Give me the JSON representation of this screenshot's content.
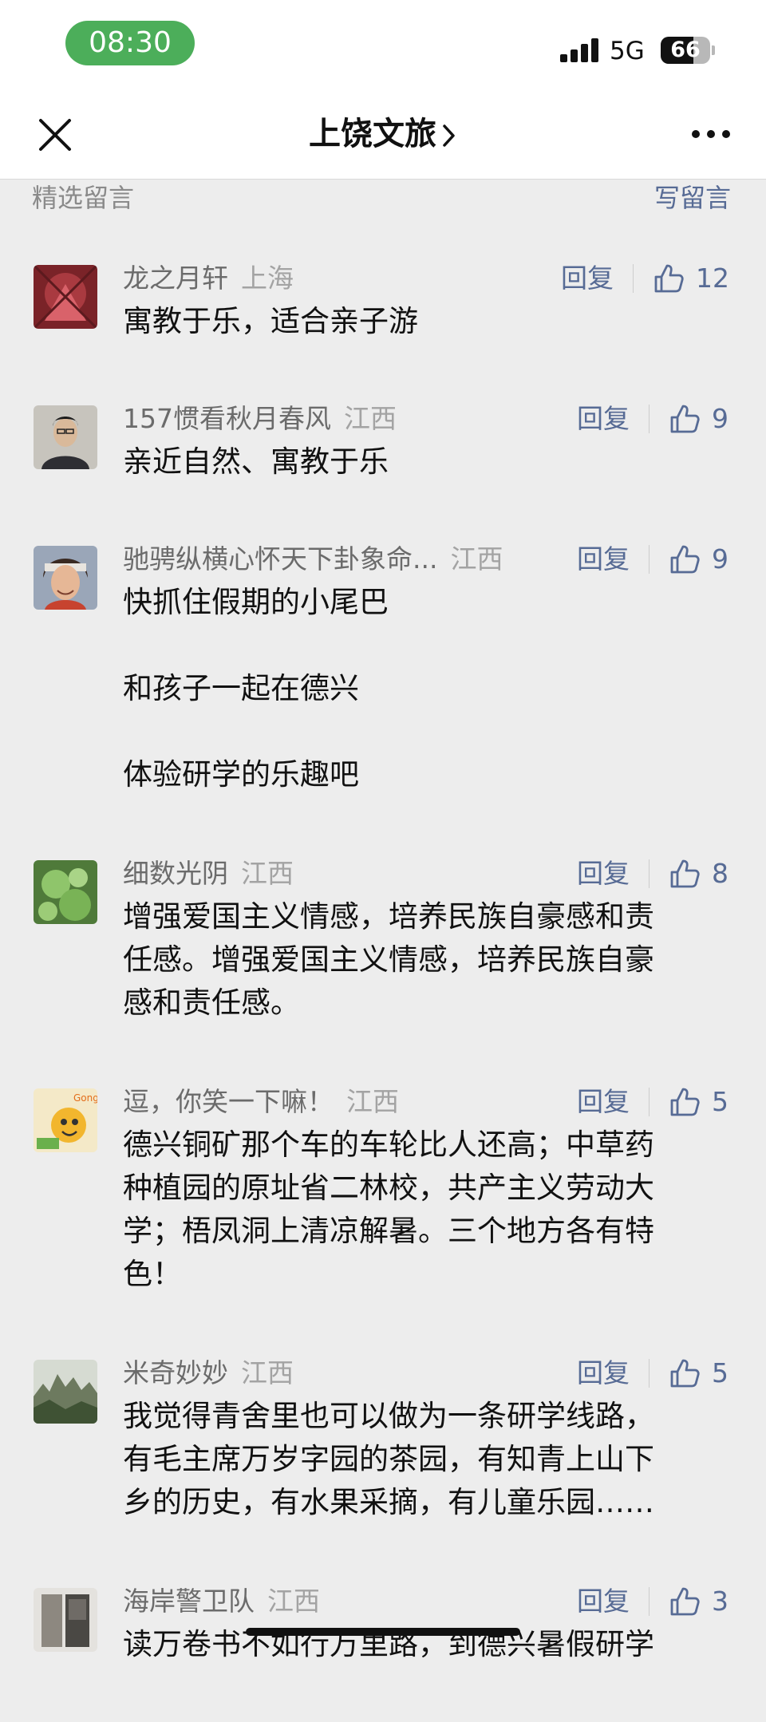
{
  "status_bar": {
    "time": "08:30",
    "network": "5G",
    "battery": "66",
    "battery_level": 0.66
  },
  "nav": {
    "title": "上饶文旅"
  },
  "section": {
    "title": "精选留言",
    "write_label": "写留言"
  },
  "reply_label": "回复",
  "comments": [
    {
      "nickname": "龙之月轩",
      "region": "上海",
      "likes": "12",
      "lines": [
        "寓教于乐，适合亲子游"
      ]
    },
    {
      "nickname": "157惯看秋月春风",
      "region": "江西",
      "likes": "9",
      "lines": [
        "亲近自然、寓教于乐"
      ]
    },
    {
      "nickname": "驰骋纵横心怀天下卦象命...",
      "region": "江西",
      "likes": "9",
      "lines": [
        "快抓住假期的小尾巴",
        "",
        "和孩子一起在德兴",
        "",
        "体验研学的乐趣吧"
      ]
    },
    {
      "nickname": "细数光阴",
      "region": "江西",
      "likes": "8",
      "lines": [
        "增强爱国主义情感，培养民族自豪感和责",
        "任感。增强爱国主义情感，培养民族自豪",
        "感和责任感。"
      ]
    },
    {
      "nickname": "逗，你笑一下嘛！",
      "region": "江西",
      "likes": "5",
      "lines": [
        "德兴铜矿那个车的车轮比人还高；中草药",
        "种植园的原址省二林校，共产主义劳动大",
        "学；梧凤洞上清凉解暑。三个地方各有特",
        "色！"
      ]
    },
    {
      "nickname": "米奇妙妙",
      "region": "江西",
      "likes": "5",
      "lines": [
        "我觉得青舍里也可以做为一条研学线路，",
        "有毛主席万岁字园的茶园，有知青上山下",
        "乡的历史，有水果采摘，有儿童乐园……"
      ]
    },
    {
      "nickname": "海岸警卫队",
      "region": "江西",
      "likes": "3",
      "lines": [
        "读万卷书不如行万里路，到德兴暑假研学"
      ]
    }
  ],
  "icons": {
    "close": "close-icon",
    "more": "more-icon",
    "like": "thumbs-up-icon",
    "chevron": "chevron-right-icon"
  },
  "colors": {
    "link": "#576b95",
    "pill": "#4cae5a",
    "background": "#ededed"
  }
}
